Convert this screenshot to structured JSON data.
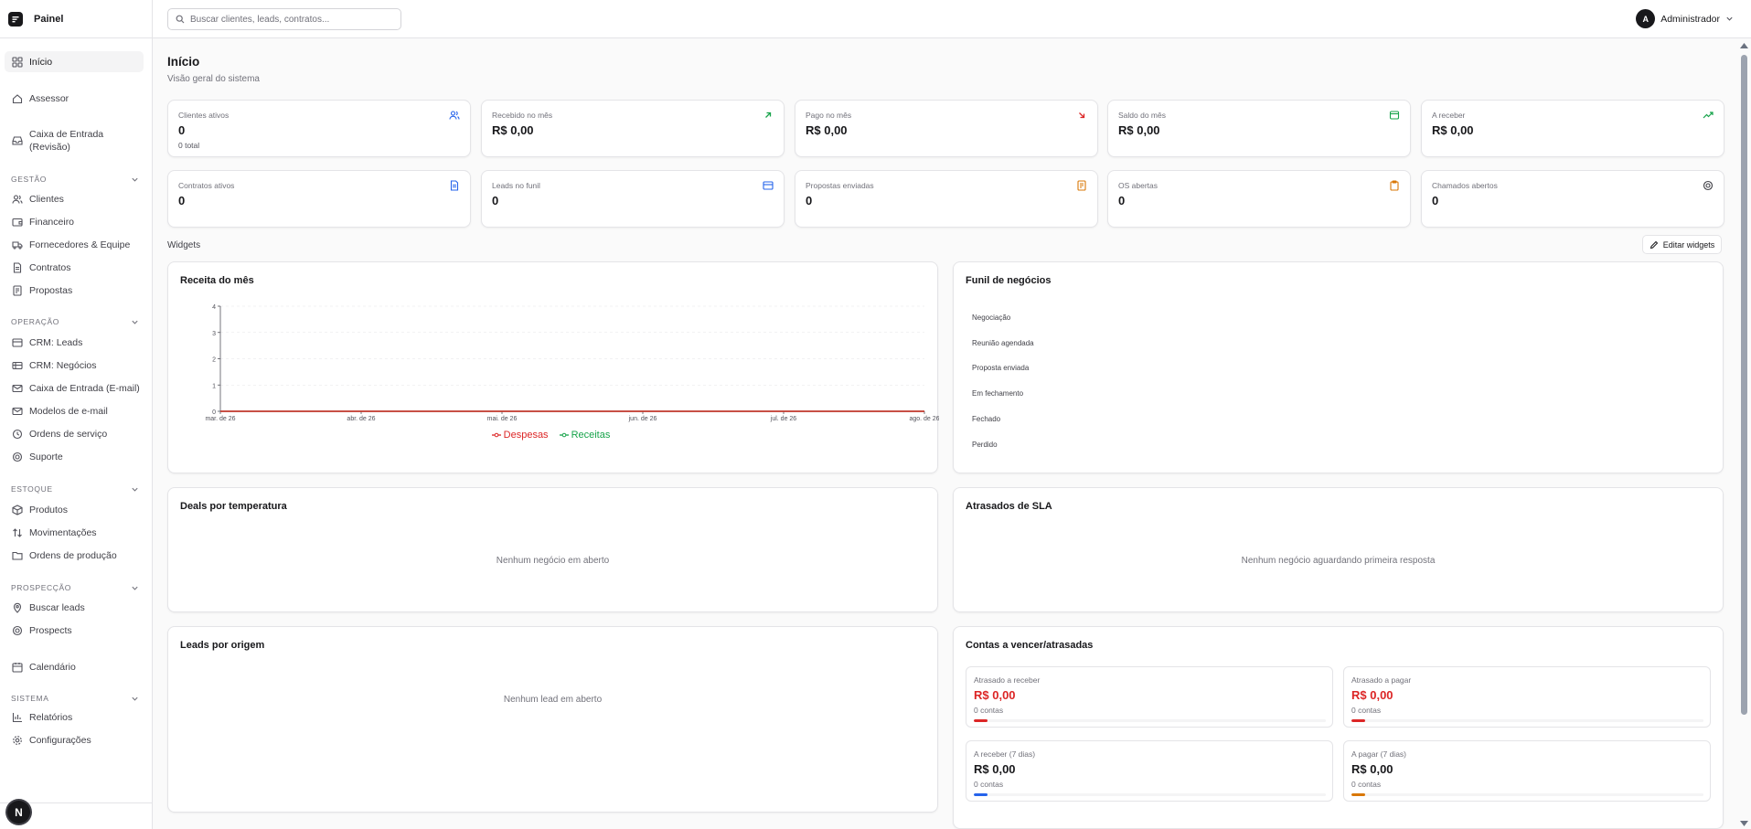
{
  "app": {
    "title": "Painel"
  },
  "search": {
    "placeholder": "Buscar clientes, leads, contratos..."
  },
  "user": {
    "initial": "A",
    "name": "Administrador"
  },
  "sidebar": {
    "top_items": [
      {
        "label": "Início",
        "icon": "dashboard-icon"
      },
      {
        "label": "Assessor",
        "icon": "house-icon"
      },
      {
        "label": "Caixa de Entrada (Revisão)",
        "icon": "inbox-icon"
      }
    ],
    "sections": [
      {
        "title": "GESTÃO",
        "items": [
          "Clientes",
          "Financeiro",
          "Fornecedores & Equipe",
          "Contratos",
          "Propostas"
        ]
      },
      {
        "title": "OPERAÇÃO",
        "items": [
          "CRM: Leads",
          "CRM: Negócios",
          "Caixa de Entrada (E-mail)",
          "Modelos de e-mail",
          "Ordens de serviço",
          "Suporte"
        ]
      },
      {
        "title": "ESTOQUE",
        "items": [
          "Produtos",
          "Movimentações",
          "Ordens de produção"
        ]
      },
      {
        "title": "PROSPECÇÃO",
        "items": [
          "Buscar leads",
          "Prospects"
        ]
      },
      {
        "title": "SISTEMA",
        "items": [
          "Relatórios",
          "Configurações"
        ]
      }
    ],
    "calendar": "Calendário",
    "footer_badge": "N"
  },
  "page": {
    "title": "Início",
    "subtitle": "Visão geral do sistema"
  },
  "stats": [
    {
      "label": "Clientes ativos",
      "value": "0",
      "sub": "0 total",
      "icon": "users-icon",
      "color": "#2563eb"
    },
    {
      "label": "Recebido no mês",
      "value": "R$ 0,00",
      "icon": "arrow-up-right-icon",
      "color": "#16a34a"
    },
    {
      "label": "Pago no mês",
      "value": "R$ 0,00",
      "icon": "arrow-down-right-icon",
      "color": "#dc2626"
    },
    {
      "label": "Saldo do mês",
      "value": "R$ 0,00",
      "icon": "wallet-icon",
      "color": "#16a34a"
    },
    {
      "label": "A receber",
      "value": "R$ 0,00",
      "icon": "trending-up-icon",
      "color": "#16a34a"
    },
    {
      "label": "Contratos ativos",
      "value": "0",
      "icon": "file-icon",
      "color": "#2563eb"
    },
    {
      "label": "Leads no funil",
      "value": "0",
      "icon": "funnel-icon",
      "color": "#2563eb"
    },
    {
      "label": "Propostas enviadas",
      "value": "0",
      "icon": "document-icon",
      "color": "#d97706"
    },
    {
      "label": "OS abertas",
      "value": "0",
      "icon": "clipboard-icon",
      "color": "#d97706"
    },
    {
      "label": "Chamados abertos",
      "value": "0",
      "icon": "lifebuoy-icon",
      "color": "#3f3f46"
    }
  ],
  "widgets": {
    "label": "Widgets",
    "edit_label": "Editar widgets"
  },
  "revenue": {
    "title": "Receita do mês"
  },
  "chart_data": {
    "type": "line",
    "title": "Receita do mês",
    "x": [
      "mar. de 26",
      "abr. de 26",
      "mai. de 26",
      "jun. de 26",
      "jul. de 26",
      "ago. de 26"
    ],
    "ylim": [
      0,
      4
    ],
    "yticks": [
      "0",
      "1",
      "2",
      "3",
      "4"
    ],
    "series": [
      {
        "name": "Despesas",
        "values": [
          0,
          0,
          0,
          0,
          0,
          0
        ],
        "color": "#dc2626"
      },
      {
        "name": "Receitas",
        "values": [
          0,
          0,
          0,
          0,
          0,
          0
        ],
        "color": "#16a34a"
      }
    ],
    "legend": "bottom",
    "grid": true
  },
  "funnel": {
    "title": "Funil de negócios",
    "stages": [
      "Negociação",
      "Reunião agendada",
      "Proposta enviada",
      "Em fechamento",
      "Fechado",
      "Perdido"
    ]
  },
  "temperature": {
    "title": "Deals por temperatura",
    "empty": "Nenhum negócio em aberto"
  },
  "sla": {
    "title": "Atrasados de SLA",
    "empty": "Nenhum negócio aguardando primeira resposta"
  },
  "origin": {
    "title": "Leads por origem",
    "empty": "Nenhum lead em aberto"
  },
  "accounts": {
    "title": "Contas a vencer/atrasadas",
    "items": [
      {
        "label": "Atrasado a receber",
        "value": "R$ 0,00",
        "sub": "0 contas",
        "value_color": "#dc2626",
        "bar_color": "#dc2626"
      },
      {
        "label": "Atrasado a pagar",
        "value": "R$ 0,00",
        "sub": "0 contas",
        "value_color": "#dc2626",
        "bar_color": "#dc2626"
      },
      {
        "label": "A receber (7 dias)",
        "value": "R$ 0,00",
        "sub": "0 contas",
        "value_color": "#18181b",
        "bar_color": "#2563eb"
      },
      {
        "label": "A pagar (7 dias)",
        "value": "R$ 0,00",
        "sub": "0 contas",
        "value_color": "#18181b",
        "bar_color": "#d97706"
      }
    ]
  }
}
